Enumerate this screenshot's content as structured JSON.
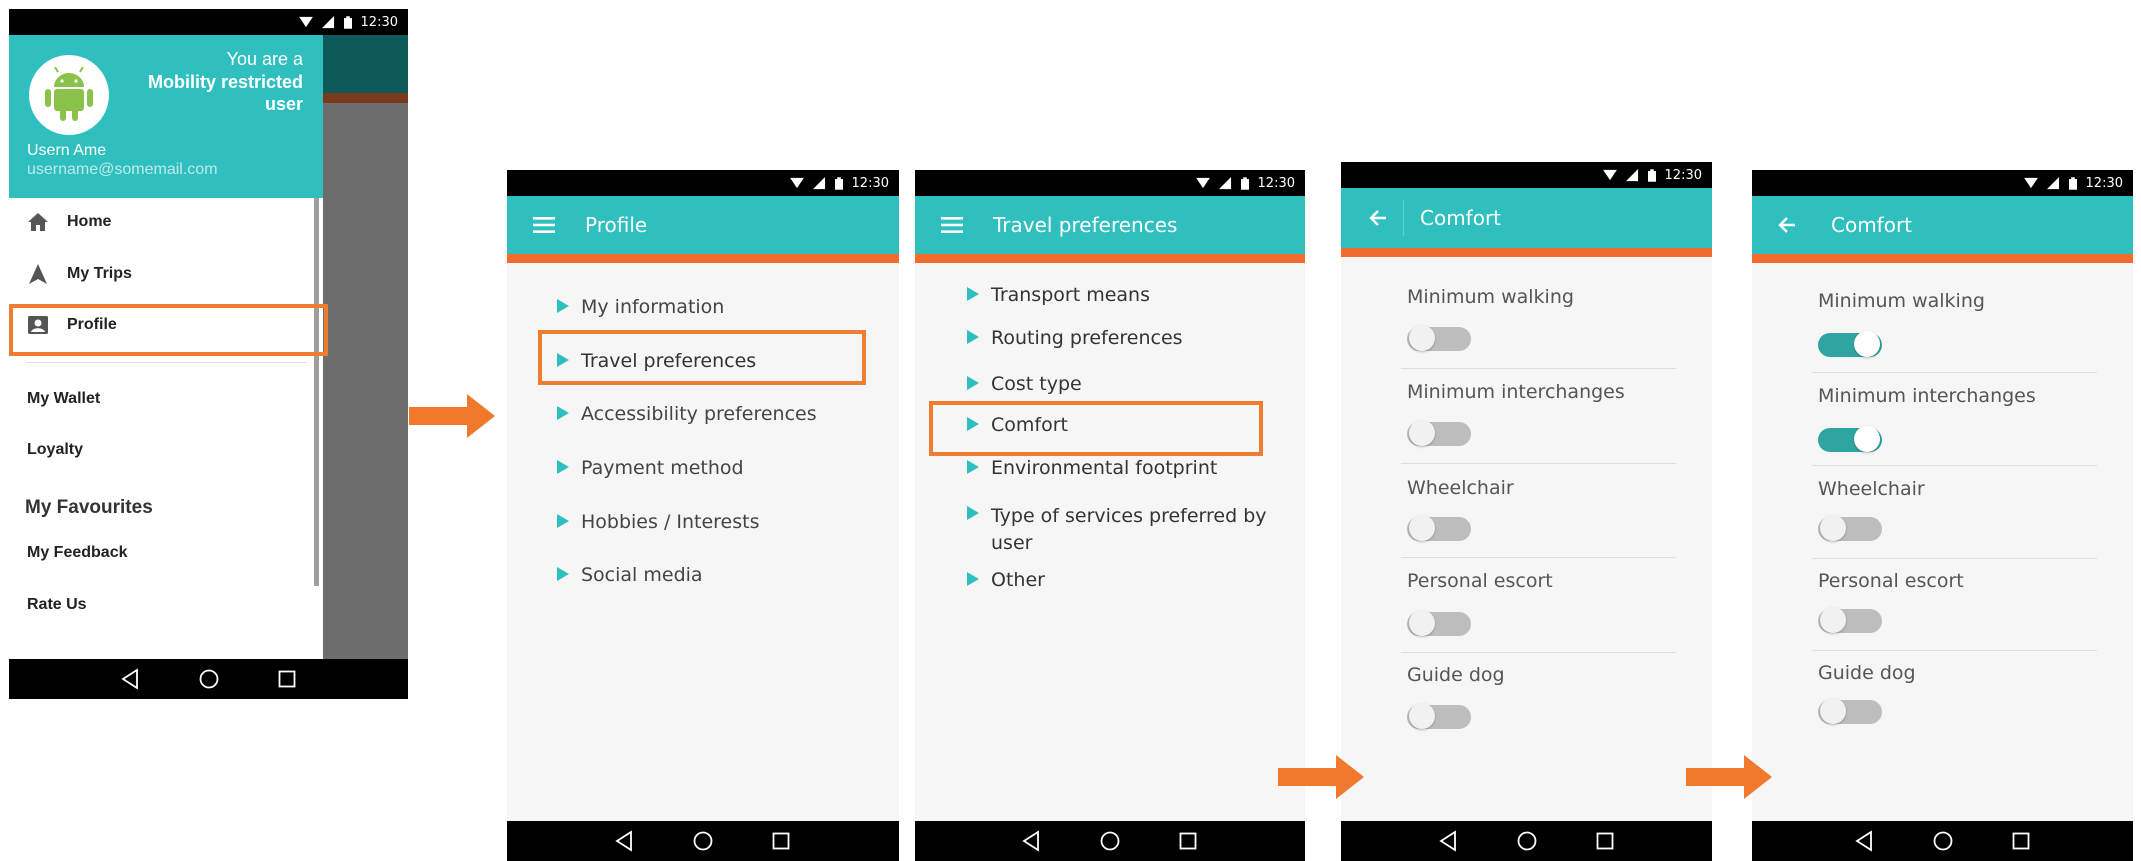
{
  "status_time": "12:30",
  "colors": {
    "primary": "#2fbfbf",
    "accent_orange": "#f26c2f",
    "highlight_orange": "#ef7d31",
    "toggle_on": "#2fa5a1"
  },
  "drawer": {
    "header": {
      "line1": "You are a",
      "line2": "Mobility restricted",
      "line3": "user",
      "username": "Usern Ame",
      "email": "username@somemail.com"
    },
    "items": [
      {
        "label": "Home",
        "icon": "home-icon"
      },
      {
        "label": "My Trips",
        "icon": "navigation-icon"
      },
      {
        "label": "Profile",
        "icon": "account-box-icon"
      }
    ],
    "secondary": [
      "My Wallet",
      "Loyalty"
    ],
    "favourites_header": "My Favourites",
    "tertiary": [
      "My Feedback",
      "Rate Us"
    ]
  },
  "profile": {
    "title": "Profile",
    "items": [
      "My information",
      "Travel preferences",
      "Accessibility preferences",
      "Payment method",
      "Hobbies / Interests",
      "Social media"
    ]
  },
  "travel": {
    "title": "Travel preferences",
    "items": [
      "Transport means",
      "Routing preferences",
      "Cost type",
      "Comfort",
      "Environmental footprint",
      "Type of services preferred by user",
      "Other"
    ]
  },
  "comfort1": {
    "title": "Comfort",
    "options": [
      {
        "label": "Minimum walking",
        "on": false
      },
      {
        "label": "Minimum interchanges",
        "on": false
      },
      {
        "label": "Wheelchair",
        "on": false
      },
      {
        "label": "Personal escort",
        "on": false
      },
      {
        "label": "Guide dog",
        "on": false
      }
    ]
  },
  "comfort2": {
    "title": "Comfort",
    "options": [
      {
        "label": "Minimum walking",
        "on": true
      },
      {
        "label": "Minimum interchanges",
        "on": true
      },
      {
        "label": "Wheelchair",
        "on": false
      },
      {
        "label": "Personal escort",
        "on": false
      },
      {
        "label": "Guide dog",
        "on": false
      }
    ]
  }
}
